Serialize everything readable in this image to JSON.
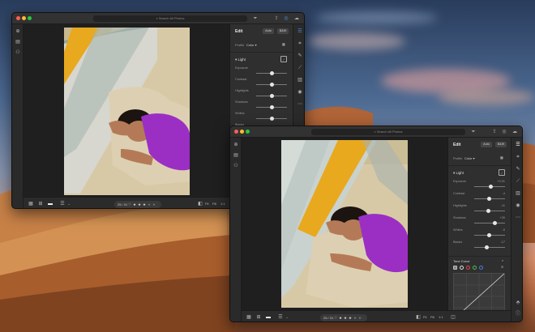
{
  "desktop": {
    "wallpaper": "desert-dunes-at-dusk"
  },
  "windows": [
    {
      "search_placeholder": "Search All Photos",
      "panel_title": "Edit",
      "mode_buttons": [
        "Auto",
        "B&W"
      ],
      "profile_label": "Profile",
      "profile_value": "Color",
      "light_section": "Light",
      "sliders": [
        {
          "label": "Exposure",
          "value": "",
          "pos": 0.5
        },
        {
          "label": "Contrast",
          "value": "",
          "pos": 0.5
        },
        {
          "label": "Highlights",
          "value": "",
          "pos": 0.5
        },
        {
          "label": "Shadows",
          "value": "",
          "pos": 0.5
        },
        {
          "label": "Whites",
          "value": "",
          "pos": 0.5
        },
        {
          "label": "Blacks",
          "value": "",
          "pos": 0.5
        }
      ],
      "page_counter": "25 / 31",
      "fit_labels": [
        "Fit",
        "Fill",
        "1:1"
      ],
      "rating": 0
    },
    {
      "search_placeholder": "Search All Photos",
      "panel_title": "Edit",
      "mode_buttons": [
        "Auto",
        "B&W"
      ],
      "profile_label": "Profile",
      "profile_value": "Color",
      "light_section": "Light",
      "sliders": [
        {
          "label": "Exposure",
          "value": "+0.31",
          "pos": 0.55
        },
        {
          "label": "Contrast",
          "value": "-4",
          "pos": 0.48
        },
        {
          "label": "Highlights",
          "value": "-11",
          "pos": 0.45
        },
        {
          "label": "Shadows",
          "value": "+39",
          "pos": 0.66
        },
        {
          "label": "Whites",
          "value": "-5",
          "pos": 0.48
        },
        {
          "label": "Blacks",
          "value": "-17",
          "pos": 0.42
        }
      ],
      "tone_curve_label": "Tone Curve",
      "page_counter": "25 / 31",
      "fit_labels": [
        "Fit",
        "Fill",
        "1:1"
      ],
      "presets_label": "Presets",
      "rating": 0
    }
  ],
  "colors": {
    "accent": "#4a90e2",
    "window_bg": "#2b2b2b",
    "panel_bg": "#2f2f2f",
    "photo_shirt": "#9b2fc4",
    "photo_stripe": "#e8a91e"
  }
}
